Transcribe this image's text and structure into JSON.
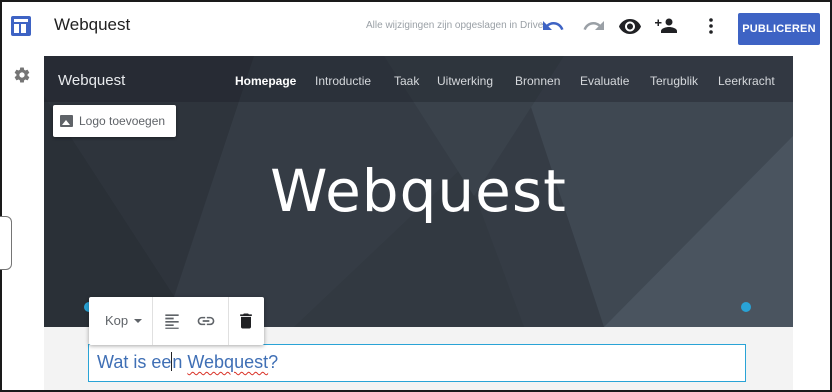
{
  "app": {
    "title": "Webquest",
    "save_status": "Alle wijzigingen zijn opgeslagen in Drive",
    "publish_label": "PUBLICEREN",
    "accent_color": "#3e63c4",
    "toolbar_icons": [
      "undo-icon",
      "redo-icon",
      "preview-eye-icon",
      "share-add-person-icon",
      "more-vert-icon"
    ]
  },
  "left_rail": {
    "icon": "gear-icon"
  },
  "site": {
    "name": "Webquest",
    "nav": [
      {
        "label": "Homepage",
        "active": true
      },
      {
        "label": "Introductie",
        "active": false
      },
      {
        "label": "Taak",
        "active": false
      },
      {
        "label": "Uitwerking",
        "active": false
      },
      {
        "label": "Bronnen",
        "active": false
      },
      {
        "label": "Evaluatie",
        "active": false
      },
      {
        "label": "Terugblik",
        "active": false
      },
      {
        "label": "Leerkracht",
        "active": false
      }
    ],
    "add_logo_label": "Logo toevoegen",
    "hero_title": "Webquest",
    "heading": {
      "part1": "Wat is ee",
      "part2": "n ",
      "part3": "Webquest",
      "part4": "?"
    }
  },
  "text_toolbar": {
    "style_label": "Kop",
    "icons": [
      "align-left-icon",
      "link-icon",
      "trash-icon"
    ]
  }
}
